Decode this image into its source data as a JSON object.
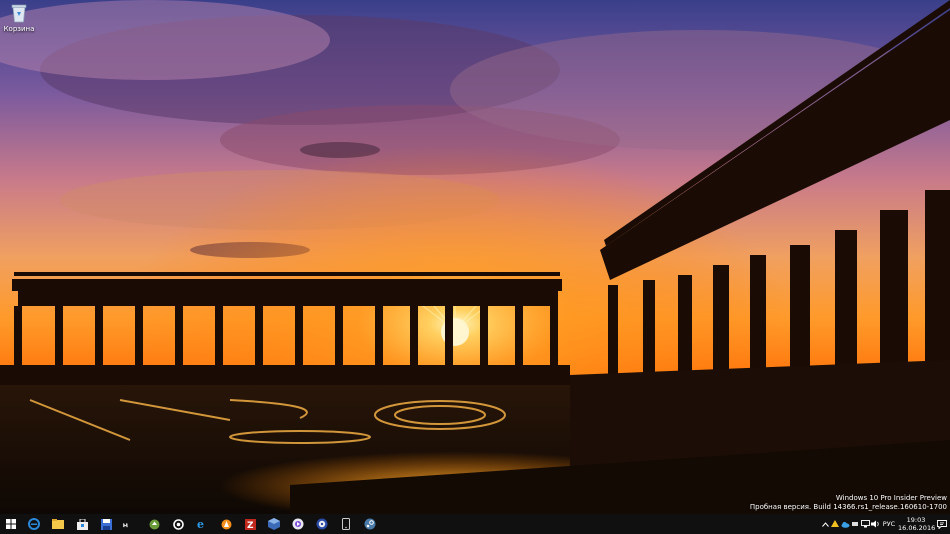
{
  "desktop": {
    "icons": [
      {
        "label": "Корзина",
        "icon": "recycle-bin-icon"
      }
    ]
  },
  "watermark": {
    "line1": "Windows 10 Pro Insider Preview",
    "line2": "Пробная версия. Build 14366.rs1_release.160610-1700"
  },
  "taskbar": {
    "pinned": [
      {
        "name": "start-icon"
      },
      {
        "name": "edge-icon"
      },
      {
        "name": "file-explorer-icon"
      },
      {
        "name": "store-icon"
      },
      {
        "name": "save-app-icon"
      },
      {
        "name": "mega-icon"
      },
      {
        "name": "recycle-app-icon"
      },
      {
        "name": "ccleaner-icon"
      },
      {
        "name": "internet-explorer-icon"
      },
      {
        "name": "avast-icon"
      },
      {
        "name": "filezilla-icon"
      },
      {
        "name": "virtualbox-icon"
      },
      {
        "name": "media-player-icon"
      },
      {
        "name": "disc-icon"
      },
      {
        "name": "mobile-icon"
      },
      {
        "name": "steam-icon"
      }
    ],
    "tray": {
      "language": "РУС",
      "time": "19:03",
      "date": "16.06.2016"
    }
  },
  "colors": {
    "taskbar": "#101010",
    "accent": "#2b88d8"
  }
}
